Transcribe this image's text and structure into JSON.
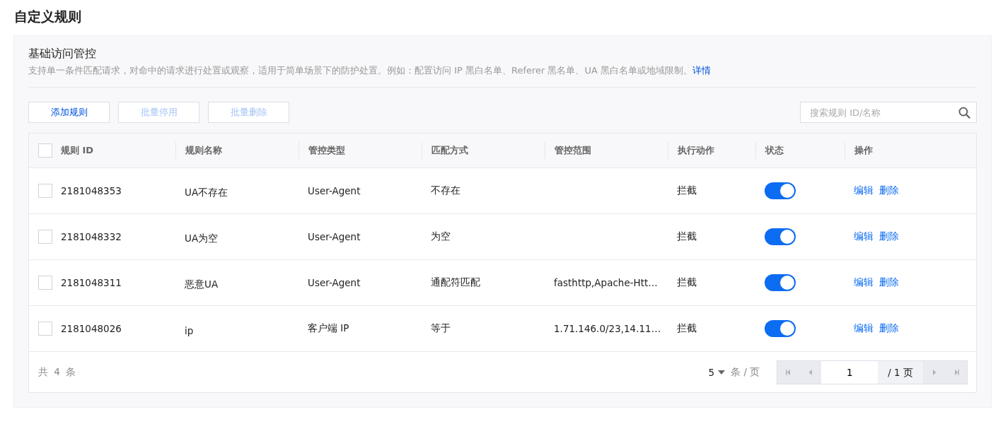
{
  "page_title": "自定义规则",
  "section": {
    "title": "基础访问管控",
    "description": "支持单一条件匹配请求，对命中的请求进行处置或观察，适用于简单场景下的防护处置。例如：配置访问 IP 黑白名单、Referer 黑名单、UA 黑白名单或地域限制。",
    "link": "详情"
  },
  "toolbar": {
    "buttons": [
      {
        "label": "添加规则",
        "disabled": false
      },
      {
        "label": "批量停用",
        "disabled": true
      },
      {
        "label": "批量删除",
        "disabled": true
      }
    ],
    "search": {
      "placeholder": "搜索规则 ID/名称"
    }
  },
  "table": {
    "select_all": {
      "checked": false
    },
    "columns": [
      "规则 ID",
      "规则名称",
      "管控类型",
      "匹配方式",
      "管控范围",
      "执行动作",
      "状态",
      "操作"
    ],
    "rows": [
      {
        "checked": false,
        "id": "2181048353",
        "name": "UA不存在",
        "type": "User-Agent",
        "match": "不存在",
        "scope": "",
        "action": "拦截",
        "on": true,
        "actions": [
          "编辑",
          "删除"
        ]
      },
      {
        "checked": false,
        "id": "2181048332",
        "name": "UA为空",
        "type": "User-Agent",
        "match": "为空",
        "scope": "",
        "action": "拦截",
        "on": true,
        "actions": [
          "编辑",
          "删除"
        ]
      },
      {
        "checked": false,
        "id": "2181048311",
        "name": "恶意UA",
        "type": "User-Agent",
        "match": "通配符匹配",
        "scope": "fasthttp,Apache-Htt…",
        "action": "拦截",
        "on": true,
        "actions": [
          "编辑",
          "删除"
        ]
      },
      {
        "checked": false,
        "id": "2181048026",
        "name": "ip",
        "type": "客户端 IP",
        "match": "等于",
        "scope": "1.71.146.0/23,14.11…",
        "action": "拦截",
        "on": true,
        "actions": [
          "编辑",
          "删除"
        ]
      }
    ]
  },
  "pagination": {
    "total": "共 4 条",
    "page_size": "5",
    "per_page": "条 / 页",
    "page": "1",
    "page_count": "/ 1 页",
    "first_disabled": true,
    "prev_disabled": true,
    "next_disabled": true,
    "last_disabled": true
  }
}
